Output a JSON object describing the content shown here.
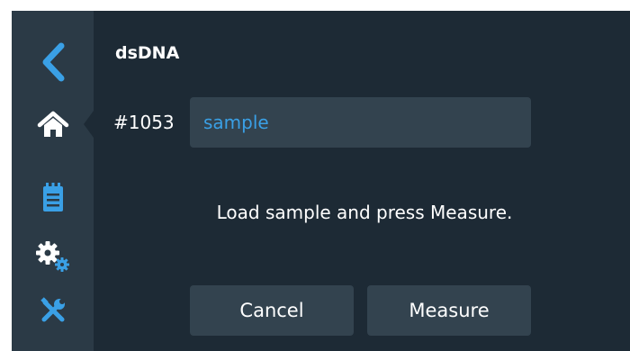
{
  "header": {
    "title": "dsDNA"
  },
  "sample": {
    "id_label": "#1053",
    "name_value": "sample"
  },
  "message": "Load sample and press Measure.",
  "buttons": {
    "cancel_label": "Cancel",
    "measure_label": "Measure"
  },
  "sidebar": {
    "items": [
      {
        "icon": "back-chevron-icon",
        "active": false
      },
      {
        "icon": "home-icon",
        "active": true
      },
      {
        "icon": "notepad-icon",
        "active": false
      },
      {
        "icon": "gears-icon",
        "active": false
      },
      {
        "icon": "tools-icon",
        "active": false
      }
    ]
  },
  "colors": {
    "background": "#1d2a35",
    "sidebar": "#2b3a46",
    "field": "#33434f",
    "accent": "#3aa0e6",
    "text": "#ffffff"
  }
}
